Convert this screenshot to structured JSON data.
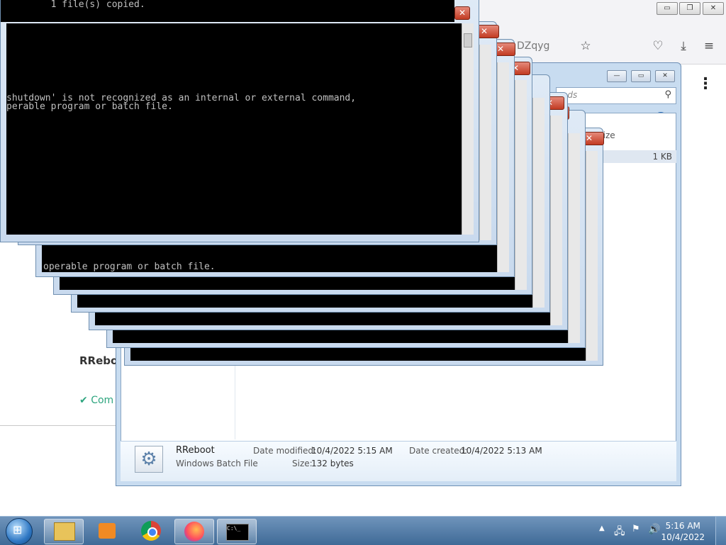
{
  "browser": {
    "url_fragment": "DZqyg",
    "window_buttons": {
      "minimize": "▭",
      "maximize": "❐",
      "close": "✕"
    },
    "page": {
      "heading": "RReboot",
      "status_text": "Com",
      "menu_icon": "⋮"
    }
  },
  "explorer": {
    "search_placeholder": "ads",
    "column_size": "Size",
    "row_size": "1 KB",
    "window_buttons": {
      "minimize": "—",
      "maximize": "▭",
      "close": "✕"
    },
    "details": {
      "name": "RReboot",
      "type": "Windows Batch File",
      "date_modified_label": "Date modified:",
      "date_modified_value": "10/4/2022 5:15 AM",
      "date_created_label": "Date created:",
      "date_created_value": "10/4/2022 5:13 AM",
      "size_label": "Size:",
      "size_value": "132 bytes"
    }
  },
  "console": {
    "top_line": "        1 file(s) copied.",
    "error_line1": "shutdown' is not recognized as an internal or external command,",
    "error_line2": "perable program or batch file.",
    "stack_line": "operable program or batch file.",
    "close_glyph": "✕",
    "min_glyph": "—",
    "max_glyph": "▭"
  },
  "taskbar": {
    "time": "5:16 AM",
    "date": "10/4/2022",
    "cmd_icon_text": "C:\\_"
  },
  "colors": {
    "taskbar": "#3f6a97",
    "close_red": "#c23b22",
    "console_bg": "#000000",
    "check_green": "#2ea57f"
  }
}
